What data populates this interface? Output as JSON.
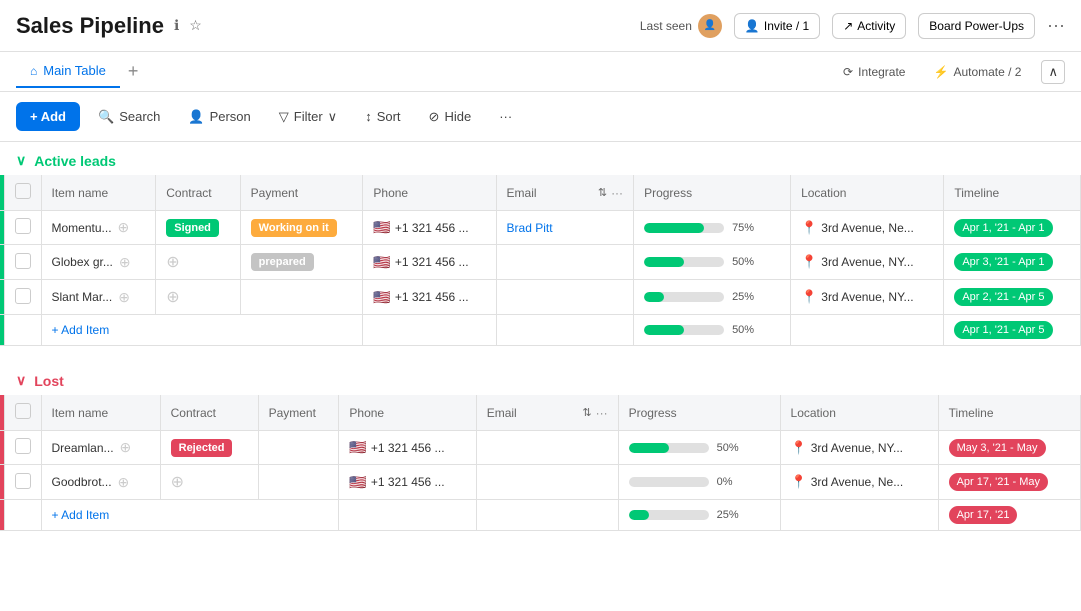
{
  "app": {
    "title": "Sales Pipeline",
    "last_seen_label": "Last seen",
    "invite_label": "Invite / 1",
    "activity_label": "Activity",
    "board_powerups_label": "Board Power-Ups",
    "integrate_label": "Integrate",
    "automate_label": "Automate / 2"
  },
  "tabs": {
    "main_table": "Main Table",
    "add_tab": "+"
  },
  "toolbar": {
    "add": "+ Add",
    "search": "Search",
    "person": "Person",
    "filter": "Filter",
    "sort": "Sort",
    "hide": "Hide",
    "more": "..."
  },
  "groups": [
    {
      "id": "active",
      "label": "Active leads",
      "color": "green",
      "columns": [
        "Item name",
        "Contract",
        "Payment",
        "Phone",
        "Email",
        "Progress",
        "Location",
        "Timeline"
      ],
      "rows": [
        {
          "name": "Momentu...",
          "contract": "Signed",
          "contract_color": "green-dark",
          "payment": "Working on it",
          "payment_color": "orange",
          "phone": "+1 321 456 ...",
          "email": "Brad Pitt",
          "email_link": true,
          "progress": 75,
          "location": "3rd Avenue, Ne...",
          "timeline": "Apr 1, '21 - Apr 1"
        },
        {
          "name": "Globex gr...",
          "contract": "",
          "contract_color": "",
          "payment": "prepared",
          "payment_color": "gray",
          "phone": "+1 321 456 ...",
          "email": "",
          "email_link": false,
          "progress": 50,
          "location": "3rd Avenue, NY...",
          "timeline": "Apr 3, '21 - Apr 1"
        },
        {
          "name": "Slant Mar...",
          "contract": "",
          "contract_color": "",
          "payment": "",
          "payment_color": "",
          "phone": "+1 321 456 ...",
          "email": "",
          "email_link": false,
          "progress": 25,
          "location": "3rd Avenue, NY...",
          "timeline": "Apr 2, '21 - Apr 5"
        },
        {
          "name": "+ Add Item",
          "is_add": true,
          "progress": 50,
          "timeline": "Apr 1, '21 - Apr 5"
        }
      ]
    },
    {
      "id": "lost",
      "label": "Lost",
      "color": "red",
      "columns": [
        "Item name",
        "Contract",
        "Payment",
        "Phone",
        "Email",
        "Progress",
        "Location",
        "Timeline"
      ],
      "rows": [
        {
          "name": "Dreamlan...",
          "contract": "Rejected",
          "contract_color": "pink",
          "payment": "",
          "payment_color": "",
          "phone": "+1 321 456 ...",
          "email": "",
          "email_link": false,
          "progress": 50,
          "location": "3rd Avenue, NY...",
          "timeline": "May 3, '21 - May"
        },
        {
          "name": "Goodbrot...",
          "contract": "",
          "contract_color": "",
          "payment": "",
          "payment_color": "",
          "phone": "+1 321 456 ...",
          "email": "",
          "email_link": false,
          "progress": 0,
          "location": "3rd Avenue, Ne...",
          "timeline": "Apr 17, '21 - May"
        },
        {
          "name": "+ Add Item",
          "is_add": true,
          "progress": 25,
          "timeline": "Apr 17, '21"
        }
      ]
    }
  ]
}
